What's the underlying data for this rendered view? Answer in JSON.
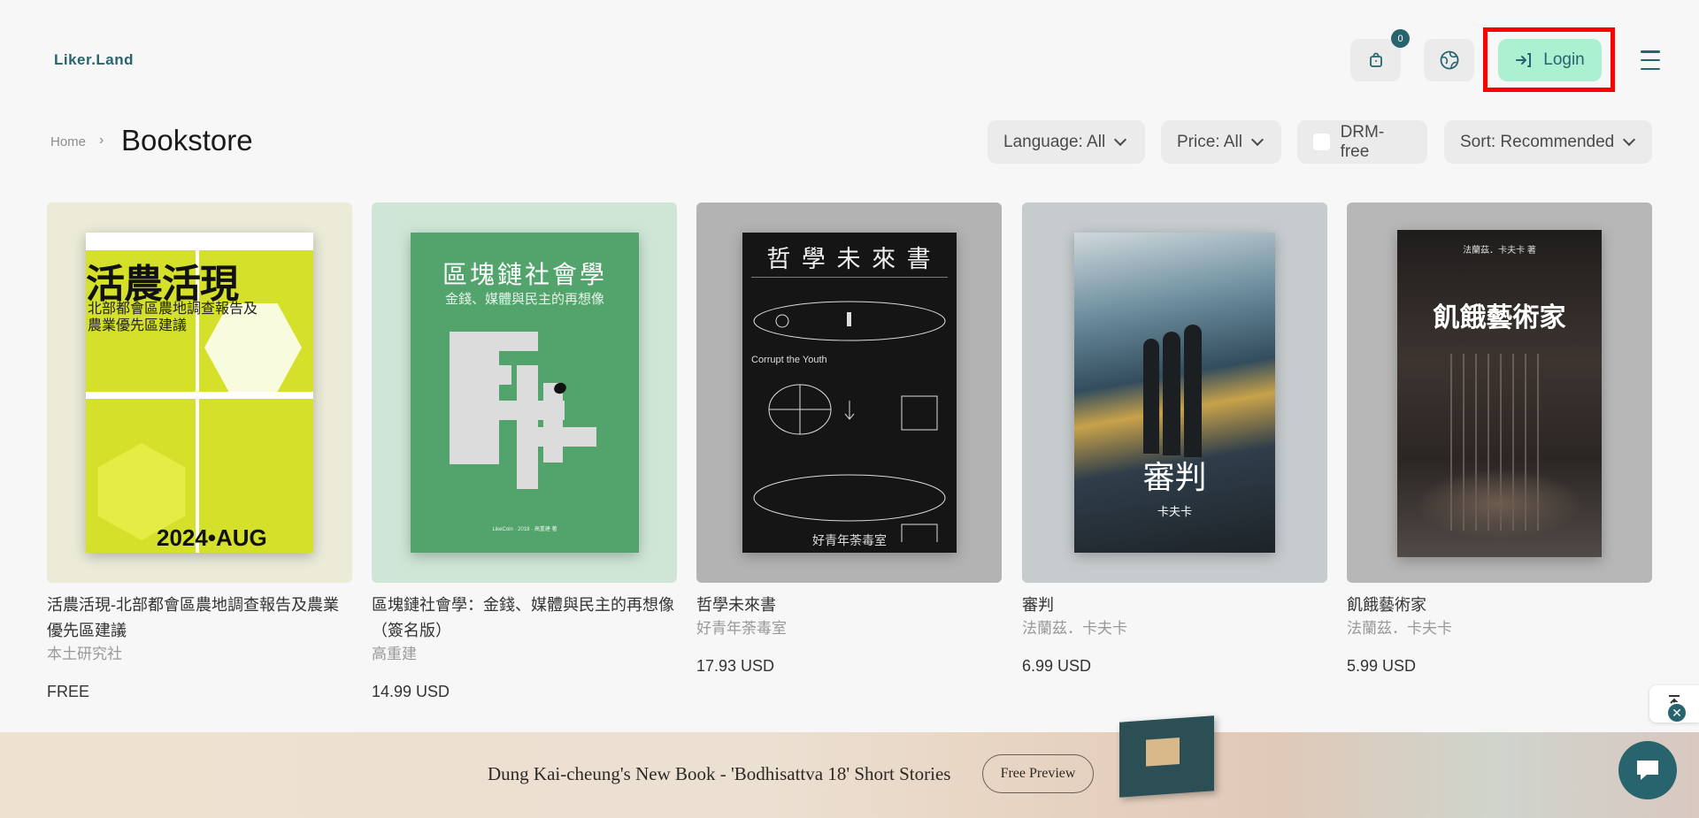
{
  "header": {
    "logo": "Liker.Land",
    "cart_count": "0",
    "login_label": "Login",
    "icons": [
      "shopping-bag-icon",
      "globe-icon",
      "login-arrow-icon",
      "menu-icon"
    ]
  },
  "breadcrumb": {
    "home": "Home",
    "separator": "›",
    "current": "Bookstore"
  },
  "filters": {
    "language": "Language: All",
    "price": "Price: All",
    "drm": "DRM-free",
    "sort": "Sort: Recommended"
  },
  "books": [
    {
      "title": "活農活現-北部都會區農地調查報告及農業優先區建議",
      "author": "本土研究社",
      "price": "FREE",
      "cover_heading": "活農活現",
      "cover_sub1": "北部都會區農地調查報告及",
      "cover_sub2": "農業優先區建議",
      "cover_date": "2024•AUG"
    },
    {
      "title": "區塊鏈社會學：金錢、媒體與民主的再想像（簽名版）",
      "author": "高重建",
      "price": "14.99 USD",
      "cover_heading": "區塊鏈社會學",
      "cover_sub1": "金錢、媒體與民主的再想像",
      "cover_footer": "LikeCoin · 2018 · 高重建 著"
    },
    {
      "title": "哲學未來書",
      "author": "好青年荼毒室",
      "price": "17.93 USD",
      "cover_heading": "哲 學 未 來 書",
      "cover_sub1": "Corrupt the Youth",
      "cover_footer": "好青年荼毒室"
    },
    {
      "title": "審判",
      "author": "法蘭茲．卡夫卡",
      "price": "6.99 USD",
      "cover_heading": "審判",
      "cover_sub1": "卡夫卡"
    },
    {
      "title": "飢餓藝術家",
      "author": "法蘭茲．卡夫卡",
      "price": "5.99 USD",
      "cover_heading": "飢餓藝術家",
      "cover_sub1": "法蘭茲．卡夫卡 著"
    }
  ],
  "banner": {
    "text": "Dung Kai-cheung's New Book - 'Bodhisattva 18' Short Stories",
    "button": "Free Preview"
  },
  "colors": {
    "brand": "#28646e",
    "login_bg": "#aaf0d1",
    "highlight": "#ff0000"
  }
}
